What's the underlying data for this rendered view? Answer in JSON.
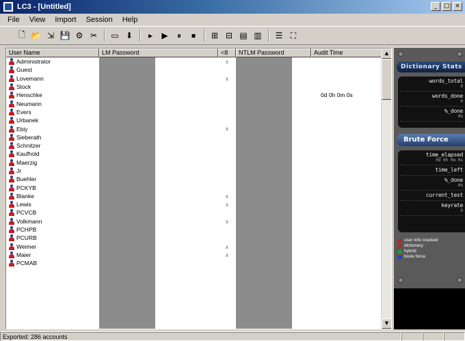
{
  "window": {
    "title": "LC3 - [Untitled]"
  },
  "window_buttons": {
    "minimize": "_",
    "maximize": "□",
    "close": "×"
  },
  "menu": [
    "File",
    "View",
    "Import",
    "Session",
    "Help"
  ],
  "toolbar": {
    "buttons": [
      {
        "icon": "new-icon",
        "glyph": "🗋"
      },
      {
        "icon": "open-icon",
        "glyph": "📂"
      },
      {
        "icon": "import-icon",
        "glyph": "⇲"
      },
      {
        "icon": "save-icon",
        "glyph": "💾"
      },
      {
        "icon": "session-icon",
        "glyph": "⚙"
      },
      {
        "icon": "tools-icon",
        "glyph": "✂"
      },
      {
        "icon": "window-icon",
        "glyph": "▭"
      },
      {
        "icon": "download-icon",
        "glyph": "⬇"
      },
      {
        "icon": "step-icon",
        "glyph": "▸"
      },
      {
        "icon": "play-icon",
        "glyph": "▶"
      },
      {
        "icon": "pause-icon",
        "glyph": "⏸"
      },
      {
        "icon": "stop-icon",
        "glyph": "⏹"
      },
      {
        "icon": "options-1-icon",
        "glyph": "⊞"
      },
      {
        "icon": "options-2-icon",
        "glyph": "⊟"
      },
      {
        "icon": "report-1-icon",
        "glyph": "▤"
      },
      {
        "icon": "report-2-icon",
        "glyph": "▥"
      },
      {
        "icon": "properties-icon",
        "glyph": "☰"
      },
      {
        "icon": "fullscreen-icon",
        "glyph": "⛶"
      }
    ]
  },
  "grid": {
    "columns": [
      "User Name",
      "LM Password",
      "<8",
      "NTLM Password",
      "Audit Time"
    ],
    "rows": [
      {
        "user": "Administrator",
        "lt8": "x",
        "audit": ""
      },
      {
        "user": "Guest",
        "lt8": "",
        "audit": ""
      },
      {
        "user": "Lovemann",
        "lt8": "x",
        "audit": ""
      },
      {
        "user": "Stock",
        "lt8": "",
        "audit": ""
      },
      {
        "user": "Henschke",
        "lt8": "",
        "audit": "0d 0h 0m 0s"
      },
      {
        "user": "Neumann",
        "lt8": "",
        "audit": ""
      },
      {
        "user": "Evers",
        "lt8": "",
        "audit": ""
      },
      {
        "user": "Urbanek",
        "lt8": "",
        "audit": ""
      },
      {
        "user": "Ebiy",
        "lt8": "x",
        "audit": ""
      },
      {
        "user": "Sieberath",
        "lt8": "",
        "audit": ""
      },
      {
        "user": "Schnitzer",
        "lt8": "",
        "audit": ""
      },
      {
        "user": "Kaufhold",
        "lt8": "",
        "audit": ""
      },
      {
        "user": "Maerzig",
        "lt8": "",
        "audit": ""
      },
      {
        "user": "Jr",
        "lt8": "",
        "audit": ""
      },
      {
        "user": "Buehler",
        "lt8": "",
        "audit": ""
      },
      {
        "user": "PCKYB",
        "lt8": "",
        "audit": ""
      },
      {
        "user": "Blanke",
        "lt8": "x",
        "audit": ""
      },
      {
        "user": "Lewis",
        "lt8": "x",
        "audit": ""
      },
      {
        "user": "PCVCB",
        "lt8": "",
        "audit": ""
      },
      {
        "user": "Volkmann",
        "lt8": "x",
        "audit": ""
      },
      {
        "user": "PCHPB",
        "lt8": "",
        "audit": ""
      },
      {
        "user": "PCURB",
        "lt8": "",
        "audit": ""
      },
      {
        "user": "Weimer",
        "lt8": "x",
        "audit": ""
      },
      {
        "user": "Maier",
        "lt8": "x",
        "audit": ""
      },
      {
        "user": "PCMAB",
        "lt8": "",
        "audit": ""
      }
    ]
  },
  "panel": {
    "header": "Dictionary Stats",
    "dictionary": [
      {
        "label": "words_total",
        "value": "0"
      },
      {
        "label": "words_done",
        "value": "0"
      },
      {
        "label": "%_done",
        "value": "0%"
      }
    ],
    "button": "Brute Force",
    "brute": [
      {
        "label": "time_elapsed",
        "value": "0d 0h 0m 0s"
      },
      {
        "label": "time_left",
        "value": ""
      },
      {
        "label": "%_done",
        "value": "0%"
      },
      {
        "label": "current_test",
        "value": ""
      },
      {
        "label": "keyrate",
        "value": "0"
      }
    ],
    "legend": [
      {
        "label": "user info cracked",
        "color": "#c02020"
      },
      {
        "label": "dictionary",
        "color": "#c02020"
      },
      {
        "label": "hybrid",
        "color": "#20a020"
      },
      {
        "label": "brute force",
        "color": "#2040c0"
      }
    ]
  },
  "status": {
    "text": "Exported: 286 accounts"
  }
}
